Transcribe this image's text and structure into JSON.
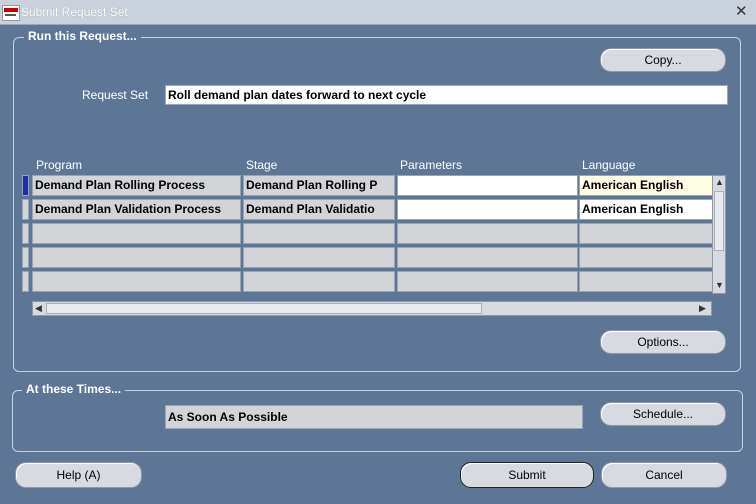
{
  "window": {
    "title": "Submit Request Set"
  },
  "run_group": {
    "legend": "Run this Request..."
  },
  "buttons": {
    "copy": "Copy...",
    "options": "Options...",
    "schedule": "Schedule...",
    "help": "Help (A)",
    "submit": "Submit",
    "cancel": "Cancel"
  },
  "request_set": {
    "label": "Request Set",
    "value": "Roll demand plan dates forward to next cycle"
  },
  "table": {
    "headers": [
      "Program",
      "Stage",
      "Parameters",
      "Language"
    ],
    "rows": [
      {
        "program": "Demand Plan Rolling Process",
        "stage": "Demand Plan Rolling P",
        "parameters": "",
        "language": "American English"
      },
      {
        "program": "Demand Plan Validation Process",
        "stage": "Demand Plan Validatio",
        "parameters": "",
        "language": "American English"
      }
    ]
  },
  "times_group": {
    "legend": "At these Times...",
    "schedule_value": "As Soon As Possible"
  }
}
